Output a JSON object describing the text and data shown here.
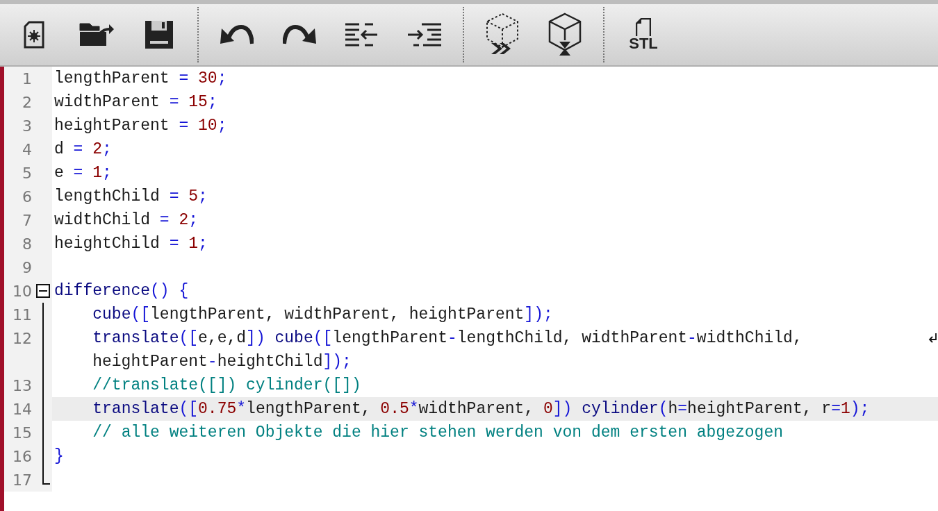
{
  "toolbar": {
    "groups": [
      [
        {
          "kind": "new"
        },
        {
          "kind": "open"
        },
        {
          "kind": "save"
        }
      ],
      [
        {
          "kind": "undo"
        },
        {
          "kind": "redo"
        },
        {
          "kind": "unindent"
        },
        {
          "kind": "indent"
        }
      ],
      [
        {
          "kind": "preview"
        },
        {
          "kind": "render"
        }
      ],
      [
        {
          "kind": "stl",
          "label": "STL"
        }
      ]
    ]
  },
  "editor": {
    "lines": [
      {
        "number": "1",
        "kind": "plain",
        "current": false,
        "segments": [
          "lengthParent = 30;"
        ]
      },
      {
        "number": "2",
        "kind": "plain",
        "current": false,
        "segments": [
          "widthParent = 15;"
        ]
      },
      {
        "number": "3",
        "kind": "plain",
        "current": false,
        "segments": [
          "heightParent = 10;"
        ]
      },
      {
        "number": "4",
        "kind": "plain",
        "current": false,
        "segments": [
          "d = 2;"
        ]
      },
      {
        "number": "5",
        "kind": "plain",
        "current": false,
        "segments": [
          "e = 1;"
        ]
      },
      {
        "number": "6",
        "kind": "plain",
        "current": false,
        "segments": [
          "lengthChild = 5;"
        ]
      },
      {
        "number": "7",
        "kind": "plain",
        "current": false,
        "segments": [
          "widthChild = 2;"
        ]
      },
      {
        "number": "8",
        "kind": "plain",
        "current": false,
        "segments": [
          "heightChild = 1;"
        ]
      },
      {
        "number": "9",
        "kind": "plain",
        "current": false
      },
      {
        "number": "10",
        "kind": "foldhead",
        "expanded": true,
        "current": false,
        "segments": [
          "difference() {"
        ]
      },
      {
        "number": "11",
        "kind": "foldbody",
        "current": false,
        "segments": [
          "    cube([lengthParent, widthParent, heightParent]);"
        ]
      },
      {
        "number": "12",
        "kind": "foldbody",
        "current": false,
        "segments": [
          "    translate([e,e,d]) cube([lengthParent-lengthChild, widthParent-widthChild,",
          "heightParent-heightChild]);"
        ]
      },
      {
        "number": "13",
        "kind": "foldbody",
        "current": false,
        "segments": [
          "    //translate([]) cylinder([])"
        ]
      },
      {
        "number": "14",
        "kind": "foldbody",
        "current": true,
        "segments": [
          "    translate([0.75*lengthParent, 0.5*widthParent, 0]) cylinder(h=heightParent, r=1);"
        ]
      },
      {
        "number": "15",
        "kind": "foldbody",
        "current": false,
        "segments": [
          "    // alle weiteren Objekte die hier stehen werden von dem ersten abgezogen"
        ]
      },
      {
        "number": "16",
        "kind": "foldbody",
        "current": false,
        "segments": [
          "}"
        ]
      },
      {
        "number": "17",
        "kind": "foldend",
        "current": false
      }
    ]
  }
}
